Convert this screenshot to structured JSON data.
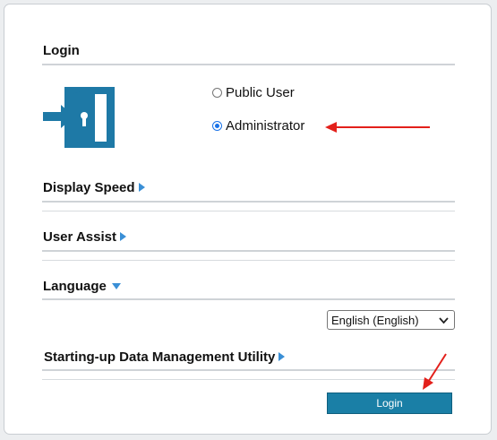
{
  "login": {
    "title": "Login",
    "options": [
      {
        "label": "Public User",
        "checked": false
      },
      {
        "label": "Administrator",
        "checked": true
      }
    ]
  },
  "sections": {
    "display_speed": "Display Speed",
    "user_assist": "User Assist",
    "language": "Language",
    "startup": "Starting-up Data Management Utility"
  },
  "language_select": {
    "value": "English (English)"
  },
  "login_button": {
    "label": "Login"
  },
  "colors": {
    "accent": "#1a7fa6",
    "arrow": "#e3201b",
    "triangle": "#3a8fd6"
  }
}
